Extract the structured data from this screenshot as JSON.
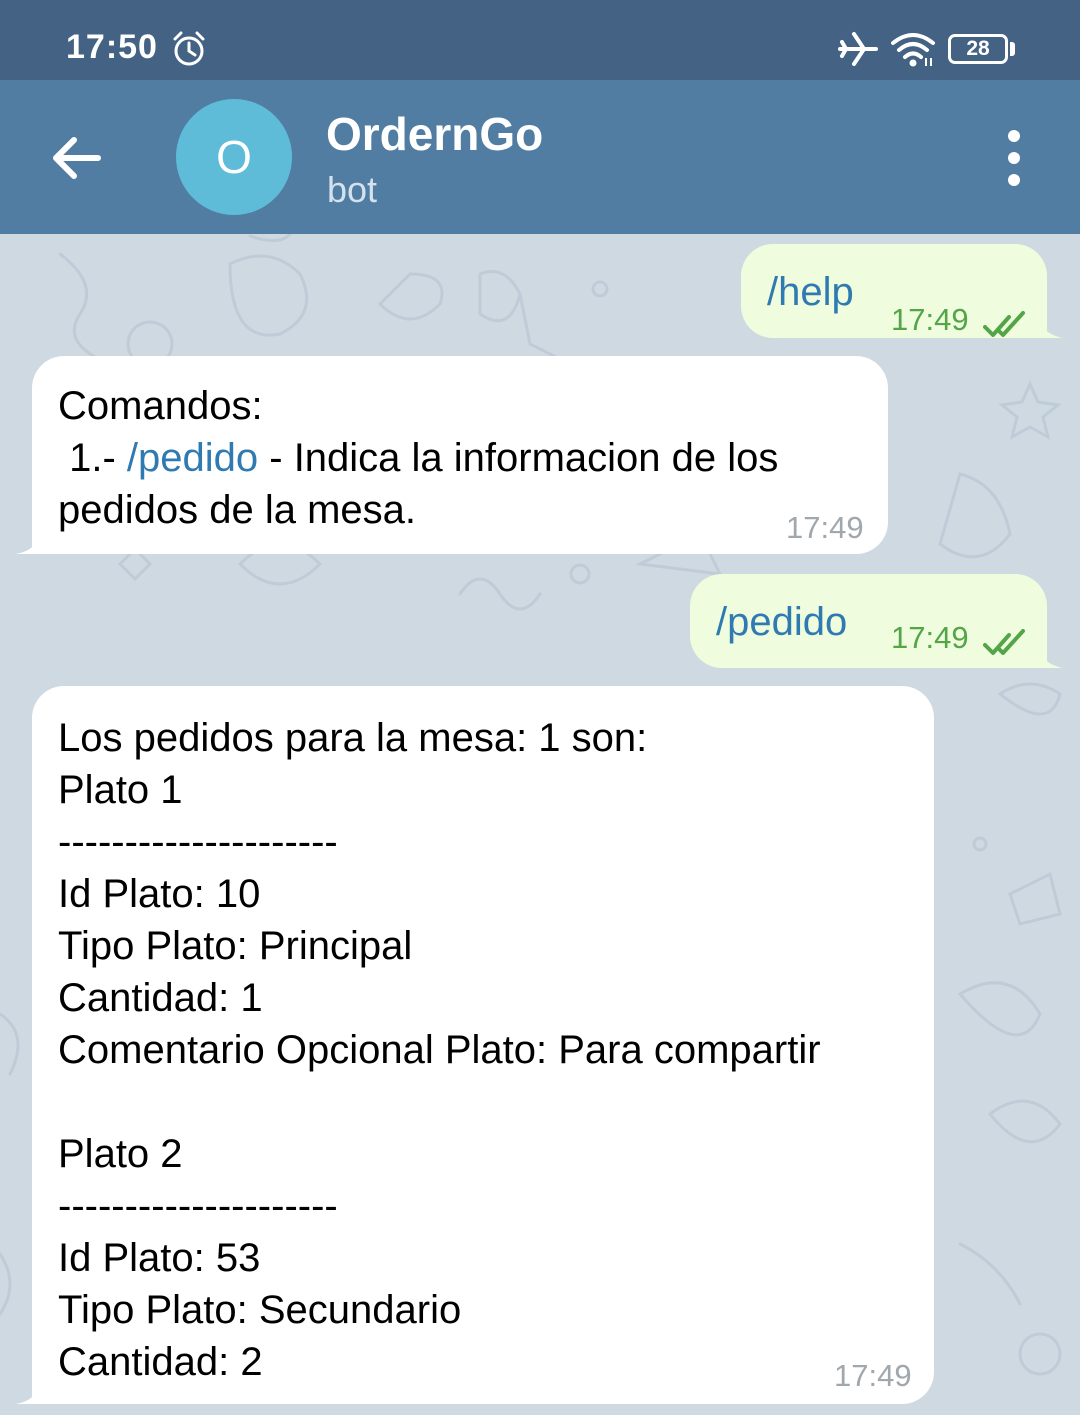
{
  "status_bar": {
    "time": "17:50",
    "battery": "28",
    "icons": [
      "alarm-icon",
      "airplane-mode-icon",
      "wifi-icon",
      "battery-icon"
    ]
  },
  "header": {
    "avatar_letter": "O",
    "title": "OrdernGo",
    "subtitle": "bot",
    "icons": [
      "back-arrow-icon",
      "more-vertical-icon"
    ],
    "colors": {
      "header": "#517da2",
      "status_bar": "#446384",
      "avatar": "#5fbcd9"
    }
  },
  "messages": [
    {
      "direction": "outgoing",
      "text": "/help",
      "time": "17:49",
      "status": "read"
    },
    {
      "direction": "incoming",
      "lines": [
        "Comandos:",
        " 1.- ",
        "/pedido",
        " - Indica la informacion de los",
        "pedidos de la mesa."
      ],
      "time": "17:49"
    },
    {
      "direction": "outgoing",
      "text": "/pedido",
      "time": "17:49",
      "status": "read"
    },
    {
      "direction": "incoming",
      "lines": [
        "Los pedidos para la mesa: 1 son:",
        "Plato 1",
        "---------------------",
        "Id Plato: 10",
        "Tipo Plato: Principal",
        "Cantidad: 1",
        "Comentario Opcional Plato: Para compartir",
        "",
        "Plato 2",
        "---------------------",
        "Id Plato: 53",
        "Tipo Plato: Secundario",
        "Cantidad: 2"
      ],
      "time": "17:49"
    }
  ],
  "colors": {
    "outgoing_bubble": "#effdde",
    "incoming_bubble": "#ffffff",
    "link": "#2f7bb1",
    "outgoing_time": "#53a548",
    "incoming_time": "#a0a7ad",
    "chat_background": "#cfd9e2"
  }
}
